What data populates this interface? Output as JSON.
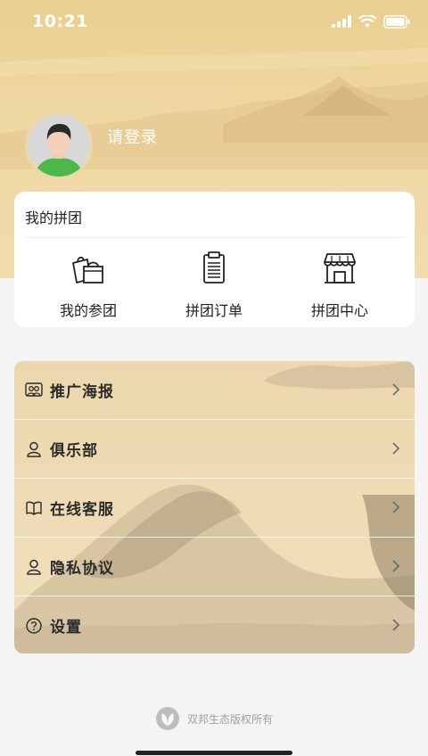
{
  "status_bar": {
    "time": "10:21"
  },
  "profile": {
    "login_text": "请登录"
  },
  "group_card": {
    "title": "我的拼团",
    "items": [
      {
        "label": "我的参团",
        "icon": "shopping-bags-icon"
      },
      {
        "label": "拼团订单",
        "icon": "clipboard-icon"
      },
      {
        "label": "拼团中心",
        "icon": "store-icon"
      }
    ]
  },
  "menu": {
    "items": [
      {
        "label": "推广海报",
        "icon": "people-icon"
      },
      {
        "label": "俱乐部",
        "icon": "person-icon"
      },
      {
        "label": "在线客服",
        "icon": "book-icon"
      },
      {
        "label": "隐私协议",
        "icon": "person-icon"
      },
      {
        "label": "设置",
        "icon": "question-icon"
      }
    ]
  },
  "footer": {
    "text": "双邦生态版权所有",
    "icon": "leaf-logo-icon"
  },
  "colors": {
    "header": "#efd7a2",
    "card_bg": "#ffffff",
    "menu_bg": "#eed9b0"
  }
}
